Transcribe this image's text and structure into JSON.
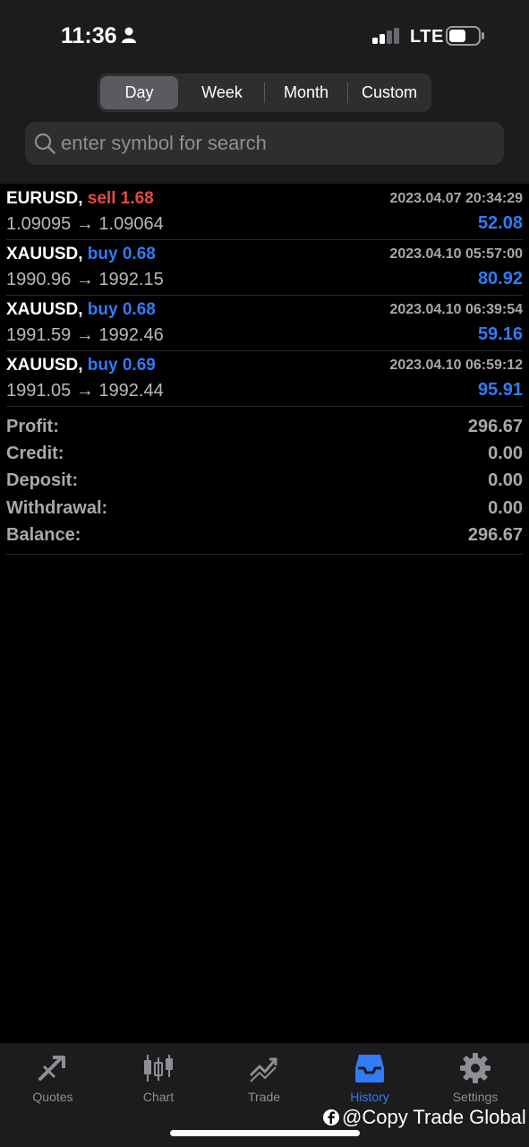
{
  "status_bar": {
    "time": "11:36",
    "network": "LTE"
  },
  "period_tabs": [
    {
      "label": "Day",
      "active": true
    },
    {
      "label": "Week",
      "active": false
    },
    {
      "label": "Month",
      "active": false
    },
    {
      "label": "Custom",
      "active": false
    }
  ],
  "search": {
    "placeholder": "enter symbol for search",
    "value": ""
  },
  "deals": [
    {
      "symbol": "EURUSD,",
      "action": "sell 1.68",
      "side": "sell",
      "time": "2023.04.07 20:34:29",
      "prices": "1.09095 → 1.09064",
      "profit": "52.08"
    },
    {
      "symbol": "XAUUSD,",
      "action": "buy 0.68",
      "side": "buy",
      "time": "2023.04.10 05:57:00",
      "prices": "1990.96 → 1992.15",
      "profit": "80.92"
    },
    {
      "symbol": "XAUUSD,",
      "action": "buy 0.68",
      "side": "buy",
      "time": "2023.04.10 06:39:54",
      "prices": "1991.59 → 1992.46",
      "profit": "59.16"
    },
    {
      "symbol": "XAUUSD,",
      "action": "buy 0.69",
      "side": "buy",
      "time": "2023.04.10 06:59:12",
      "prices": "1991.05 → 1992.44",
      "profit": "95.91"
    }
  ],
  "summary": [
    {
      "label": "Profit:",
      "value": "296.67"
    },
    {
      "label": "Credit:",
      "value": "0.00"
    },
    {
      "label": "Deposit:",
      "value": "0.00"
    },
    {
      "label": "Withdrawal:",
      "value": "0.00"
    },
    {
      "label": "Balance:",
      "value": "296.67"
    }
  ],
  "tab_bar": [
    {
      "label": "Quotes",
      "icon": "quotes-icon",
      "active": false
    },
    {
      "label": "Chart",
      "icon": "chart-icon",
      "active": false
    },
    {
      "label": "Trade",
      "icon": "trade-icon",
      "active": false
    },
    {
      "label": "History",
      "icon": "history-icon",
      "active": true
    },
    {
      "label": "Settings",
      "icon": "settings-icon",
      "active": false
    }
  ],
  "watermark": "@Copy Trade Global",
  "colors": {
    "sell": "#e84a43",
    "buy": "#2f7cf6",
    "profit": "#2f7cf6",
    "active_tab": "#2f7cf6",
    "inactive_tab": "#8e8e93"
  }
}
